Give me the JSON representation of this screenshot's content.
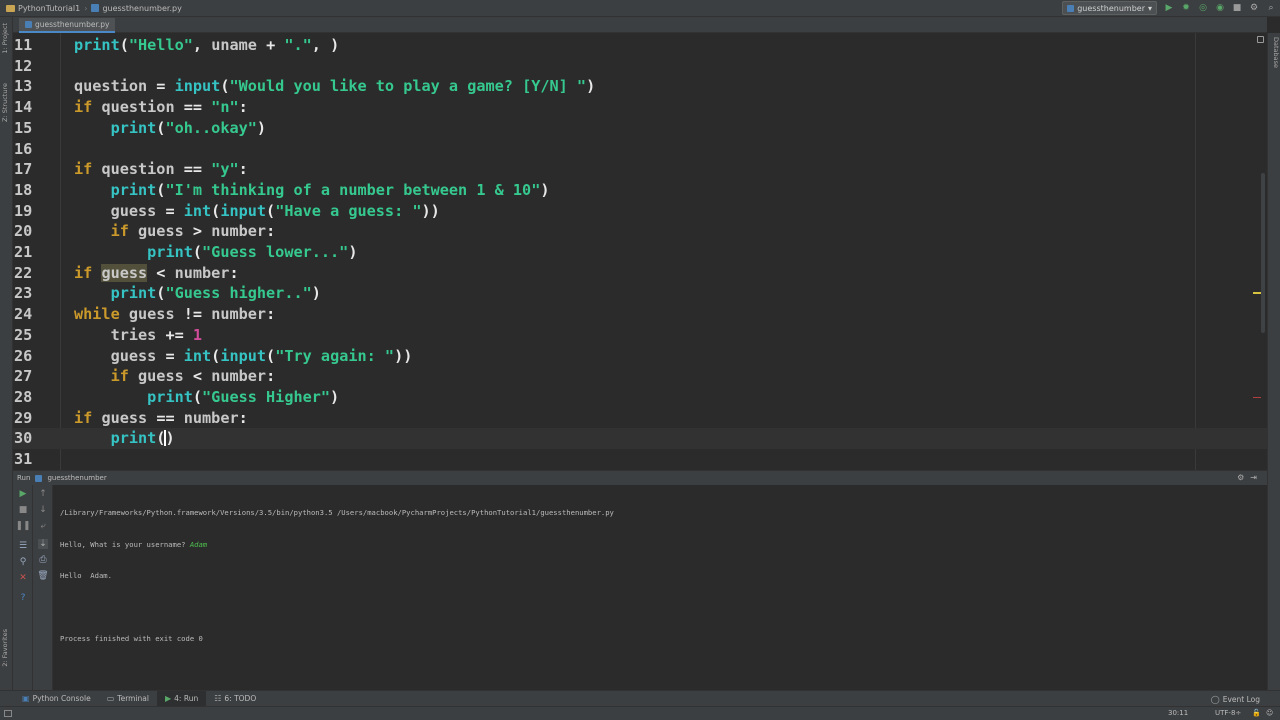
{
  "navbar": {
    "project": "PythonTutorial1",
    "file": "guessthenumber.py",
    "run_config": "guessthenumber"
  },
  "tabs": [
    {
      "label": "guessthenumber.py"
    }
  ],
  "left_strip": {
    "project_label": "1: Project",
    "structure_label": "Z: Structure",
    "favorites_label": "2: Favorites"
  },
  "right_strip": {
    "database_label": "Database"
  },
  "editor": {
    "lines": [
      {
        "num": "11",
        "tokens": [
          [
            "bi",
            "print"
          ],
          [
            "op",
            "("
          ],
          [
            "str",
            "\"Hello\""
          ],
          [
            "op",
            ", "
          ],
          [
            "id",
            "uname "
          ],
          [
            "op",
            "+ "
          ],
          [
            "str",
            "\".\""
          ],
          [
            "op",
            ", )"
          ]
        ]
      },
      {
        "num": "12",
        "tokens": []
      },
      {
        "num": "13",
        "tokens": [
          [
            "id",
            "question "
          ],
          [
            "op",
            "= "
          ],
          [
            "bi",
            "input"
          ],
          [
            "op",
            "("
          ],
          [
            "str",
            "\"Would you like to play a game? [Y/N] \""
          ],
          [
            "op",
            ")"
          ]
        ]
      },
      {
        "num": "14",
        "tokens": [
          [
            "kw",
            "if "
          ],
          [
            "id",
            "question "
          ],
          [
            "op",
            "== "
          ],
          [
            "str",
            "\"n\""
          ],
          [
            "op",
            ":"
          ]
        ]
      },
      {
        "num": "15",
        "tokens": [
          [
            "id",
            "    "
          ],
          [
            "bi",
            "print"
          ],
          [
            "op",
            "("
          ],
          [
            "str",
            "\"oh..okay\""
          ],
          [
            "op",
            ")"
          ]
        ]
      },
      {
        "num": "16",
        "tokens": []
      },
      {
        "num": "17",
        "tokens": [
          [
            "kw",
            "if "
          ],
          [
            "id",
            "question "
          ],
          [
            "op",
            "== "
          ],
          [
            "str",
            "\"y\""
          ],
          [
            "op",
            ":"
          ]
        ]
      },
      {
        "num": "18",
        "tokens": [
          [
            "id",
            "    "
          ],
          [
            "bi",
            "print"
          ],
          [
            "op",
            "("
          ],
          [
            "str",
            "\"I'm thinking of a number between 1 & 10\""
          ],
          [
            "op",
            ")"
          ]
        ]
      },
      {
        "num": "19",
        "tokens": [
          [
            "id",
            "    guess "
          ],
          [
            "op",
            "= "
          ],
          [
            "bi",
            "int"
          ],
          [
            "op",
            "("
          ],
          [
            "bi",
            "input"
          ],
          [
            "op",
            "("
          ],
          [
            "str",
            "\"Have a guess: \""
          ],
          [
            "op",
            "))"
          ]
        ]
      },
      {
        "num": "20",
        "tokens": [
          [
            "id",
            "    "
          ],
          [
            "kw",
            "if "
          ],
          [
            "id",
            "guess "
          ],
          [
            "op",
            "> "
          ],
          [
            "id",
            "number"
          ],
          [
            "op",
            ":"
          ]
        ]
      },
      {
        "num": "21",
        "tokens": [
          [
            "id",
            "        "
          ],
          [
            "bi",
            "print"
          ],
          [
            "op",
            "("
          ],
          [
            "str",
            "\"Guess lower...\""
          ],
          [
            "op",
            ")"
          ]
        ]
      },
      {
        "num": "22",
        "tokens": [
          [
            "kw",
            "if "
          ],
          [
            "hl",
            "guess"
          ],
          [
            "op",
            " < "
          ],
          [
            "id",
            "number"
          ],
          [
            "op",
            ":"
          ]
        ]
      },
      {
        "num": "23",
        "tokens": [
          [
            "id",
            "    "
          ],
          [
            "bi",
            "print"
          ],
          [
            "op",
            "("
          ],
          [
            "str",
            "\"Guess higher..\""
          ],
          [
            "op",
            ")"
          ]
        ]
      },
      {
        "num": "24",
        "tokens": [
          [
            "kw",
            "while "
          ],
          [
            "id",
            "guess "
          ],
          [
            "op",
            "!= "
          ],
          [
            "id",
            "number"
          ],
          [
            "op",
            ":"
          ]
        ]
      },
      {
        "num": "25",
        "tokens": [
          [
            "id",
            "    tries "
          ],
          [
            "op",
            "+= "
          ],
          [
            "num",
            "1"
          ]
        ]
      },
      {
        "num": "26",
        "tokens": [
          [
            "id",
            "    guess "
          ],
          [
            "op",
            "= "
          ],
          [
            "bi",
            "int"
          ],
          [
            "op",
            "("
          ],
          [
            "bi",
            "input"
          ],
          [
            "op",
            "("
          ],
          [
            "str",
            "\"Try again: \""
          ],
          [
            "op",
            "))"
          ]
        ]
      },
      {
        "num": "27",
        "tokens": [
          [
            "id",
            "    "
          ],
          [
            "kw",
            "if "
          ],
          [
            "id",
            "guess "
          ],
          [
            "op",
            "< "
          ],
          [
            "id",
            "number"
          ],
          [
            "op",
            ":"
          ]
        ]
      },
      {
        "num": "28",
        "tokens": [
          [
            "id",
            "        "
          ],
          [
            "bi",
            "print"
          ],
          [
            "op",
            "("
          ],
          [
            "str",
            "\"Guess Higher\""
          ],
          [
            "op",
            ")"
          ]
        ]
      },
      {
        "num": "29",
        "tokens": [
          [
            "kw",
            "if "
          ],
          [
            "id",
            "guess "
          ],
          [
            "op",
            "== "
          ],
          [
            "id",
            "number"
          ],
          [
            "op",
            ":"
          ]
        ]
      },
      {
        "num": "30",
        "tokens": [
          [
            "id",
            "    "
          ],
          [
            "bi",
            "print"
          ],
          [
            "op",
            "("
          ],
          [
            "caret",
            ""
          ],
          [
            "op",
            ")"
          ]
        ],
        "current": true
      },
      {
        "num": "31",
        "tokens": []
      }
    ]
  },
  "run_panel": {
    "header_label": "Run",
    "config_name": "guessthenumber",
    "console": {
      "command": "/Library/Frameworks/Python.framework/Versions/3.5/bin/python3.5 /Users/macbook/PycharmProjects/PythonTutorial1/guessthenumber.py",
      "prompt": "Hello, What is your username? ",
      "user_input": "Adam",
      "greeting": "Hello  Adam.",
      "blank": "",
      "exit": "Process finished with exit code 0"
    }
  },
  "bottom_bar": {
    "python_console": "Python Console",
    "terminal": "Terminal",
    "run": "4: Run",
    "todo": "6: TODO",
    "event_log": "Event Log"
  },
  "status_bar": {
    "position": "30:11",
    "encoding": "UTF-8÷"
  },
  "colors": {
    "background": "#2b2b2b",
    "keyword": "#cc9a2b",
    "builtin": "#36c3c3",
    "string": "#36c98f",
    "number": "#d14c9a",
    "console_input": "#4fc24f"
  }
}
